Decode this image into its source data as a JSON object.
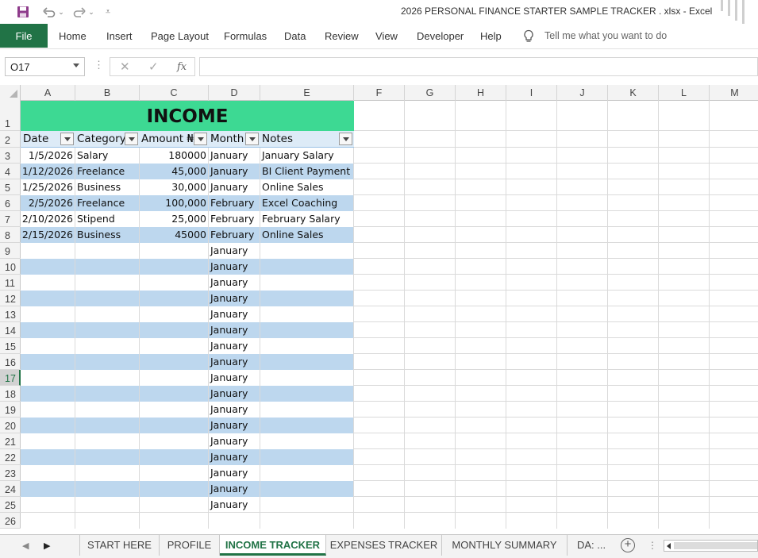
{
  "window": {
    "title": "2026 PERSONAL FINANCE STARTER SAMPLE TRACKER . xlsx  -  Excel"
  },
  "quick_access": {
    "save_icon": "save-icon",
    "undo_icon": "undo-icon",
    "redo_icon": "redo-icon",
    "customize_icon": "customize-qat-icon"
  },
  "ribbon": {
    "file": "File",
    "tabs": [
      "Home",
      "Insert",
      "Page Layout",
      "Formulas",
      "Data",
      "Review",
      "View",
      "Developer",
      "Help"
    ],
    "tell_me": "Tell me what you want to do"
  },
  "formula_bar": {
    "name_box": "O17",
    "cancel_glyph": "✕",
    "enter_glyph": "✓",
    "fx_glyph": "fx",
    "formula": ""
  },
  "columns": [
    "A",
    "B",
    "C",
    "D",
    "E",
    "F",
    "G",
    "H",
    "I",
    "J",
    "K",
    "L",
    "M"
  ],
  "rows": [
    "1",
    "2",
    "3",
    "4",
    "5",
    "6",
    "7",
    "8",
    "9",
    "10",
    "11",
    "12",
    "13",
    "14",
    "15",
    "16",
    "17",
    "18",
    "19",
    "20",
    "21",
    "22",
    "23",
    "24",
    "25",
    "26"
  ],
  "active_row": "17",
  "sheet": {
    "title": "INCOME",
    "headers": [
      "Date",
      "Category",
      "Amount ₦",
      "Month",
      "Notes"
    ],
    "data_rows": [
      {
        "date": "1/5/2026",
        "category": "Salary",
        "amount": "180000",
        "month": "January",
        "notes": "January Salary"
      },
      {
        "date": "1/12/2026",
        "category": "Freelance",
        "amount": "45,000",
        "month": "January",
        "notes": "BI Client Payment"
      },
      {
        "date": "1/25/2026",
        "category": "Business",
        "amount": "30,000",
        "month": "January",
        "notes": "Online Sales"
      },
      {
        "date": "2/5/2026",
        "category": "Freelance",
        "amount": "100,000",
        "month": "February",
        "notes": "Excel Coaching"
      },
      {
        "date": "2/10/2026",
        "category": "Stipend",
        "amount": "25,000",
        "month": "February",
        "notes": "February Salary"
      },
      {
        "date": "2/15/2026",
        "category": "Business",
        "amount": "45000",
        "month": "February",
        "notes": "Online Sales"
      }
    ],
    "empty_month_values": [
      "January",
      "January",
      "January",
      "January",
      "January",
      "January",
      "January",
      "January",
      "January",
      "January",
      "January",
      "January",
      "January",
      "January",
      "January",
      "January",
      "January"
    ]
  },
  "sheet_tabs": {
    "tabs": [
      "START HERE",
      "PROFILE",
      "INCOME TRACKER",
      "EXPENSES TRACKER",
      "MONTHLY SUMMARY",
      "DA: ..."
    ],
    "active": "INCOME TRACKER",
    "add_glyph": "+"
  },
  "colors": {
    "brand": "#217346",
    "title_fill": "#3dd993",
    "band_fill": "#bdd7ee",
    "header_fill": "#ddebf7"
  }
}
